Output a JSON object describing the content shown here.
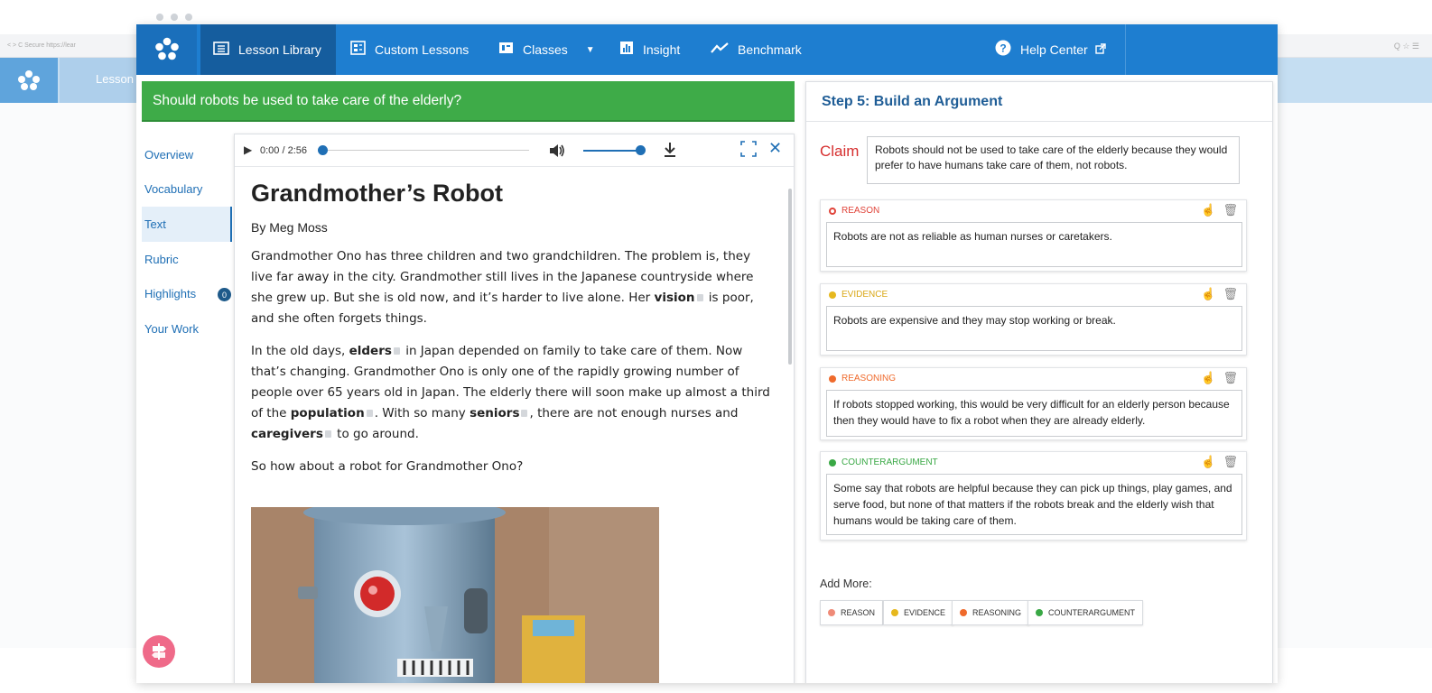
{
  "background": {
    "address_text": "< > C  Secure  https://lear",
    "address_icons": "Q ☆ ☰",
    "nav_lesson_label": "Lesson"
  },
  "nav": {
    "items": [
      {
        "label": "Lesson Library",
        "icon": "book-icon"
      },
      {
        "label": "Custom Lessons",
        "icon": "grid-icon"
      },
      {
        "label": "Classes",
        "icon": "classes-icon"
      },
      {
        "label": "Insight",
        "icon": "bar-chart-icon"
      },
      {
        "label": "Benchmark",
        "icon": "trend-icon"
      }
    ],
    "help_label": "Help Center"
  },
  "question": "Should robots be used to take care of the elderly?",
  "sidebar": {
    "items": [
      {
        "label": "Overview"
      },
      {
        "label": "Vocabulary"
      },
      {
        "label": "Text"
      },
      {
        "label": "Rubric"
      },
      {
        "label": "Highlights"
      },
      {
        "label": "Your Work"
      }
    ],
    "highlights_count": "0"
  },
  "audio": {
    "time": "0:00 / 2:56",
    "progress": 0,
    "volume": 1
  },
  "article": {
    "title": "Grandmother’s Robot",
    "byline": "By Meg Moss",
    "p1": "Grandmother Ono has three children and two grandchildren. The problem is, they live far away in the city. Grandmother still lives in the Japanese countryside where she grew up. But she is old now, and it’s harder to live alone. Her",
    "p1_bold": "vision",
    "p1_end": "is poor, and she often forgets things.",
    "p2_a": "In the old days,",
    "p2_b1": "elders",
    "p2_c": "in Japan depended on family to take care of them. Now that’s changing. Grandmother Ono is only one of the rapidly growing number of people over 65 years old in Japan. The elderly there will soon make up almost a third of the",
    "p2_b2": "population",
    "p2_d": ". With so many",
    "p2_b3": "seniors",
    "p2_e": ", there are not enough nurses and",
    "p2_b4": "caregivers",
    "p2_f": "to go around.",
    "p3": "So how about a robot for Grandmother Ono?"
  },
  "argument": {
    "step_title": "Step 5: Build an Argument",
    "claim_label": "Claim",
    "claim_text": "Robots should not be used to take care of the elderly because they would prefer to have humans take care of them, not robots.",
    "cards": [
      {
        "type": "REASON",
        "color": "#e0443a",
        "text": "Robots are not as reliable as human nurses or caretakers."
      },
      {
        "type": "EVIDENCE",
        "color": "#e6b81e",
        "text": "Robots are expensive and they may stop working or break."
      },
      {
        "type": "REASONING",
        "color": "#ef6a2c",
        "text": "If robots stopped working, this would be very difficult for an elderly person because then they would have to fix a robot when they are already elderly."
      },
      {
        "type": "COUNTERARGUMENT",
        "color": "#39a845",
        "text": "Some say that robots are helpful because they can pick up things, play games, and serve food, but none of that matters if the robots break and the elderly wish that humans would be taking care of them."
      }
    ],
    "add_more_label": "Add More:",
    "add_buttons": [
      {
        "label": "REASON",
        "color": "#ef8b78"
      },
      {
        "label": "EVIDENCE",
        "color": "#e6b81e"
      },
      {
        "label": "REASONING",
        "color": "#ef6a2c"
      },
      {
        "label": "COUNTERARGUMENT",
        "color": "#39a845"
      }
    ]
  }
}
